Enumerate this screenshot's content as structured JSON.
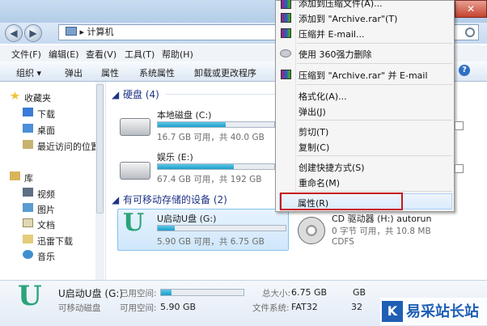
{
  "address": {
    "path": "计算机",
    "separator": "▸"
  },
  "menubar": [
    "文件(F)",
    "编辑(E)",
    "查看(V)",
    "工具(T)",
    "帮助(H)"
  ],
  "toolbar": [
    "组织 ▾",
    "弹出",
    "属性",
    "系统属性",
    "卸载或更改程序"
  ],
  "nav": {
    "favorites": "收藏夹",
    "fav_items": [
      "下载",
      "桌面",
      "最近访问的位置"
    ],
    "library": "库",
    "lib_items": [
      "视频",
      "图片",
      "文档",
      "迅雷下载",
      "音乐"
    ]
  },
  "hdd_group": "硬盘 (4)",
  "drives": [
    {
      "name": "本地磁盘 (C:)",
      "space": "16.7 GB 可用，共 40.0 GB",
      "fill": 0.58
    },
    {
      "name": "娱乐 (E:)",
      "space": "67.4 GB 可用，共 192 GB",
      "fill": 0.65
    }
  ],
  "removable_group": "有可移动存储的设备 (2)",
  "udisk": {
    "name": "U启动U盘 (G:)",
    "space": "5.90 GB 可用，共 6.75 GB",
    "fill": 0.13,
    "logo": "U"
  },
  "cd": {
    "name": "CD 驱动器 (H:) autorun",
    "space": "0 字节 可用，共 10.8 MB",
    "fs": "CDFS"
  },
  "context_menu": [
    "添加到压缩文件(A)...",
    "添加到 \"Archive.rar\"(T)",
    "压缩并 E-mail...",
    "使用 360强力删除",
    "压缩到 \"Archive.rar\" 并 E-mail",
    "格式化(A)...",
    "弹出(J)",
    "剪切(T)",
    "复制(C)",
    "创建快捷方式(S)",
    "重命名(M)",
    "属性(R)"
  ],
  "details": {
    "name": "U启动U盘 (G:)",
    "type": "可移动磁盘",
    "used_label": "已用空间:",
    "free_label": "可用空间:",
    "free_value": "5.90 GB",
    "total_label": "总大小:",
    "total_value": "6.75 GB",
    "fs_label": "文件系统:",
    "fs_value": "FAT32",
    "gb_a": "GB",
    "gb_b": "32",
    "used_fill": 0.13
  },
  "watermark": {
    "logo": "K",
    "text": "易采站长站"
  },
  "colors": {
    "highlight_border": "#c8171d",
    "group_header": "#1e3287",
    "capacity_fill": "#1b9ecb"
  }
}
